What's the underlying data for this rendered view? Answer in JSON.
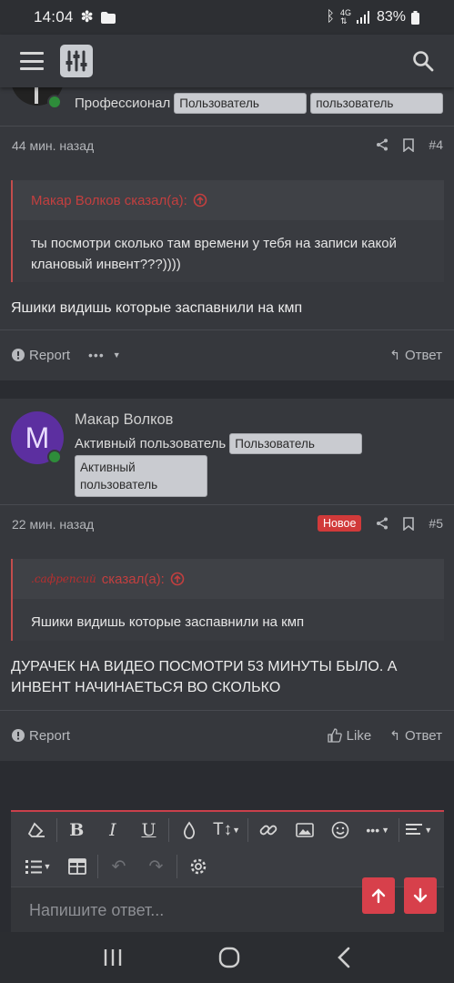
{
  "status_bar": {
    "time": "14:04",
    "battery": "83%"
  },
  "post1": {
    "user_title": "Профессионал",
    "tags": [
      "Пользователь",
      "пользователь"
    ],
    "time": "44 мин. назад",
    "number": "#4",
    "quote_author": "Макар Волков сказал(а):",
    "quote_text": "ты посмотри сколько там времени у тебя на записи какой клановый инвент???))))",
    "text": "Яшики видишь которые заспавнили на кмп",
    "report": "Report",
    "reply": "Ответ"
  },
  "post2": {
    "avatar_letter": "M",
    "username": "Макар Волков",
    "user_title": "Активный пользователь",
    "tags": [
      "Пользователь",
      "Активный пользователь"
    ],
    "time": "22 мин. назад",
    "new_badge": "Новое",
    "number": "#5",
    "quote_author_name": ".сафрепсий",
    "quote_author_suffix": "сказал(а):",
    "quote_text": "Яшики видишь которые заспавнили на кмп",
    "text": "ДУРАЧЕК НА ВИДЕО ПОСМОТРИ 53 МИНУТЫ БЫЛО. А ИНВЕНТ НАЧИНАЕТЬСЯ ВО СКОЛЬКО",
    "report": "Report",
    "like": "Like",
    "reply": "Ответ"
  },
  "editor": {
    "placeholder": "Напишите ответ..."
  },
  "colors": {
    "accent": "#d7404b",
    "avatar": "#5c2fa0",
    "online": "#2e8c3a"
  }
}
